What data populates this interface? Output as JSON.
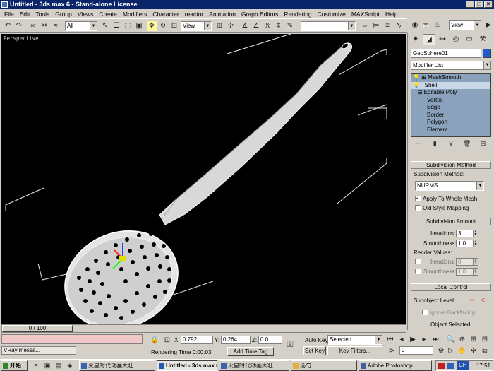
{
  "titlebar": {
    "title": "Untitled - 3ds max 6 - Stand-alone License"
  },
  "menu": [
    "File",
    "Edit",
    "Tools",
    "Group",
    "Views",
    "Create",
    "Modifiers",
    "Character",
    "reactor",
    "Animation",
    "Graph Editors",
    "Rendering",
    "Customize",
    "MAXScript",
    "Help"
  ],
  "toolbar": {
    "selection_filter": "All",
    "ref_coord": "View",
    "ref_coord2": "View"
  },
  "viewport": {
    "label": "Perspective"
  },
  "command_panel": {
    "object_name": "GeoSphere01",
    "object_color": "#1e5dc8",
    "modifier_list": "Modifier List",
    "stack": [
      "MeshSmooth",
      "Shell",
      "Editable Poly",
      "Vertex",
      "Edge",
      "Border",
      "Polygon",
      "Element"
    ],
    "subdivision_method": {
      "title": "Subdivision Method",
      "label": "Subdivision Method:",
      "value": "NURMS",
      "apply_whole": "Apply To Whole Mesh",
      "old_style": "Old Style Mapping"
    },
    "subdivision_amount": {
      "title": "Subdivision Amount",
      "iterations_label": "Iterations:",
      "iterations": "3",
      "smoothness_label": "Smoothness:",
      "smoothness": "1.0",
      "render_values": "Render Values:",
      "r_iterations_label": "Iterations:",
      "r_iterations": "0",
      "r_smoothness_label": "Smoothness:",
      "r_smoothness": "1.0"
    },
    "local_control": {
      "title": "Local Control",
      "subobject_level": "Subobject Level:",
      "ignore_backfacing": "Ignore Backfacing",
      "object_selected": "Object Selected"
    }
  },
  "bottom": {
    "time_slider": "0 / 100",
    "vray_label": "VRay messa...",
    "x_label": "X:",
    "x": "0.792",
    "y_label": "Y:",
    "y": "0.264",
    "z_label": "Z:",
    "z": "0.0",
    "rendering_time": "Rendering Time  0:00:03",
    "add_time_tag": "Add Time Tag",
    "auto_key": "Auto Key",
    "set_key": "Set Key",
    "selected": "Selected",
    "key_filters": "Key Filters...",
    "frame": "0"
  },
  "taskbar": {
    "start": "开始",
    "tasks": [
      "火星时代动画大壮...",
      "Untitled - 3ds max 6 - ...",
      "火星时代动画大壮...",
      "汤勺",
      "Adobe Photoshop"
    ],
    "lang": "CH",
    "clock": "17:51"
  }
}
